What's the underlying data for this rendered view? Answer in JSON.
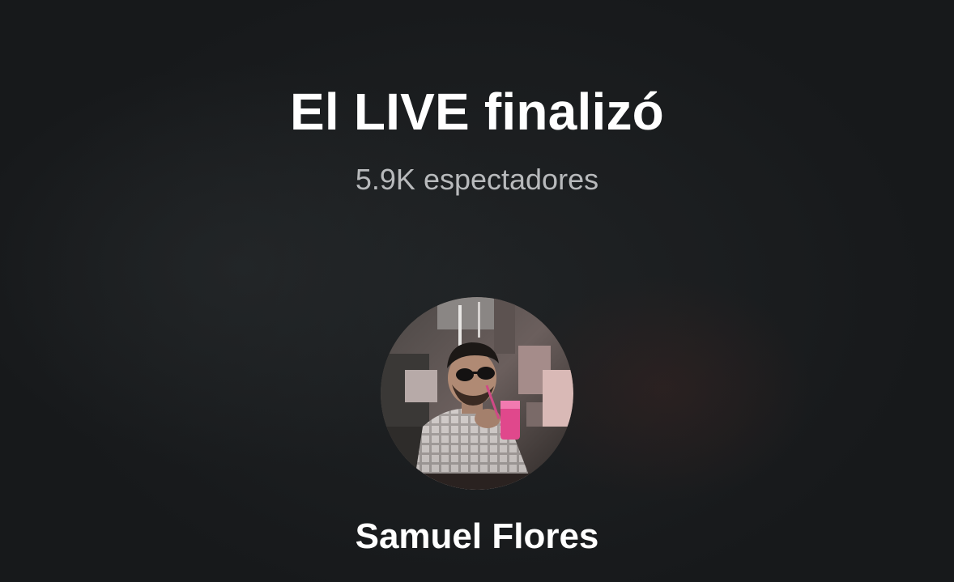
{
  "live_ended": {
    "title": "El LIVE finalizó",
    "viewers_text": "5.9K espectadores",
    "host": {
      "name": "Samuel Flores",
      "avatar_icon": "profile-photo-avatar"
    }
  },
  "colors": {
    "background": "#17191b",
    "title": "#ffffff",
    "viewers": "#b8babc",
    "name": "#ffffff"
  }
}
